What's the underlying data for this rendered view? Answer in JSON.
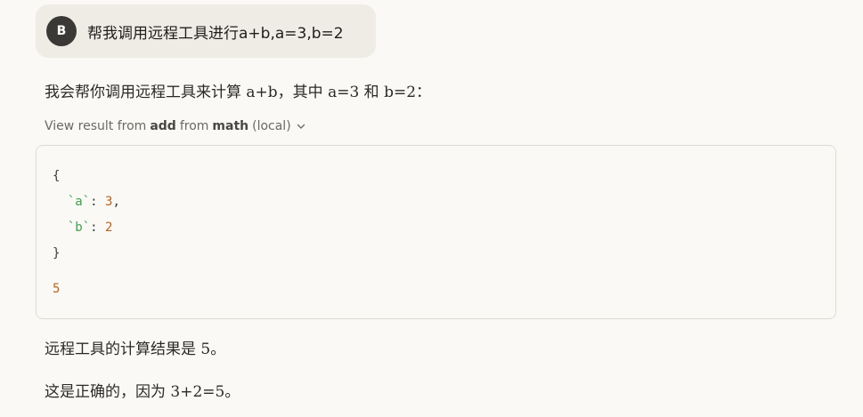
{
  "user_message": {
    "avatar_initial": "B",
    "text": "帮我调用远程工具进行a+b,a=3,b=2"
  },
  "assistant": {
    "intro": "我会帮你调用远程工具来计算 a+b，其中 a=3 和 b=2：",
    "tool_call": {
      "prefix": "View result from",
      "tool": "add",
      "joiner": "from",
      "server": "math",
      "suffix": "(local)",
      "chevron_icon": "chevron-down-icon"
    },
    "tool_input": {
      "open_brace": "{",
      "entries": [
        {
          "key": "`a`",
          "sep": ": ",
          "value": "3",
          "trail": ","
        },
        {
          "key": "`b`",
          "sep": ": ",
          "value": "2",
          "trail": ""
        }
      ],
      "close_brace": "}"
    },
    "tool_output": "5",
    "result_text": "远程工具的计算结果是 5。",
    "verify_text": "这是正确的，因为 3+2=5。"
  },
  "colors": {
    "background": "#faf9f6",
    "bubble": "#efece6",
    "avatar": "#3a3935",
    "key_green": "#3d9f4a",
    "number_orange": "#b5651d"
  }
}
